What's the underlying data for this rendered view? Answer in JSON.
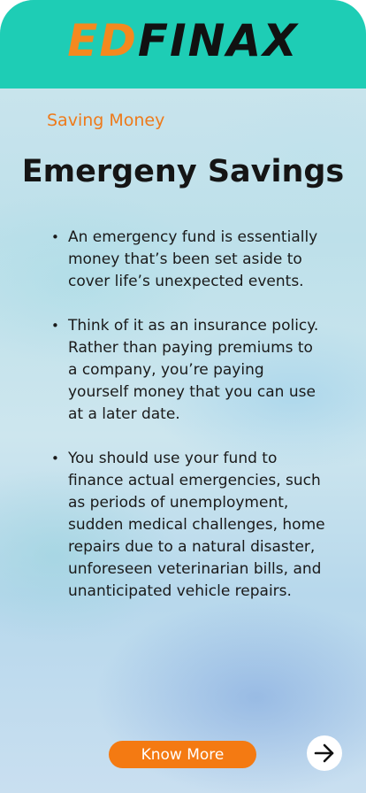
{
  "header": {
    "logo_part1": "ED",
    "logo_part2": "FINAX",
    "background_color": "#1ecdb5"
  },
  "lesson": {
    "category": "Saving Money",
    "title": "Emergeny Savings",
    "bullets": [
      "An emergency fund is essentially money that’s been set aside to cover life’s unexpected events.",
      "Think of it as an insurance policy. Rather than paying premiums to a company, you’re paying yourself money that you can use at a later date.",
      "You should use your fund to finance actual emergencies, such as periods of unemployment, sudden medical challenges, home repairs due to a natural disaster, unforeseen veterinarian bills, and unanticipated vehicle repairs."
    ]
  },
  "footer": {
    "know_more_label": "Know More",
    "next_icon": "arrow-right-icon",
    "accent_color": "#f47a12"
  }
}
